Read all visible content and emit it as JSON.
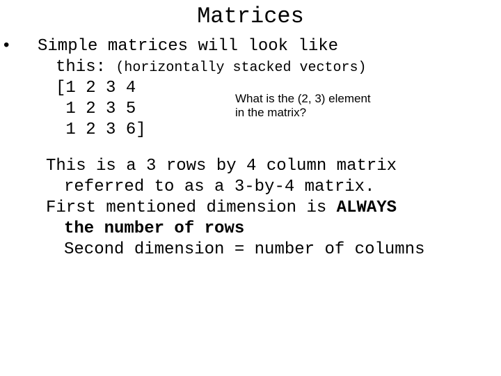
{
  "title": "Matrices",
  "bullet_lead": "Simple matrices will look like",
  "bullet_cont": "this:",
  "subnote": "(horizontally stacked vectors)",
  "matrix": {
    "row1": "[1 2 3 4",
    "row2": " 1 2 3 5",
    "row3": " 1 2 3 6]"
  },
  "question": {
    "line1": "What is the (2, 3) element",
    "line2": "in the matrix?"
  },
  "desc": {
    "l1": "This is a 3 rows by 4 column matrix",
    "l2": "referred to as a 3-by-4 matrix.",
    "l3a": "First mentioned dimension is ",
    "l3b": "ALWAYS",
    "l4b": "the number of rows",
    "l5": "Second dimension = number of columns"
  },
  "bullet_char": "•"
}
